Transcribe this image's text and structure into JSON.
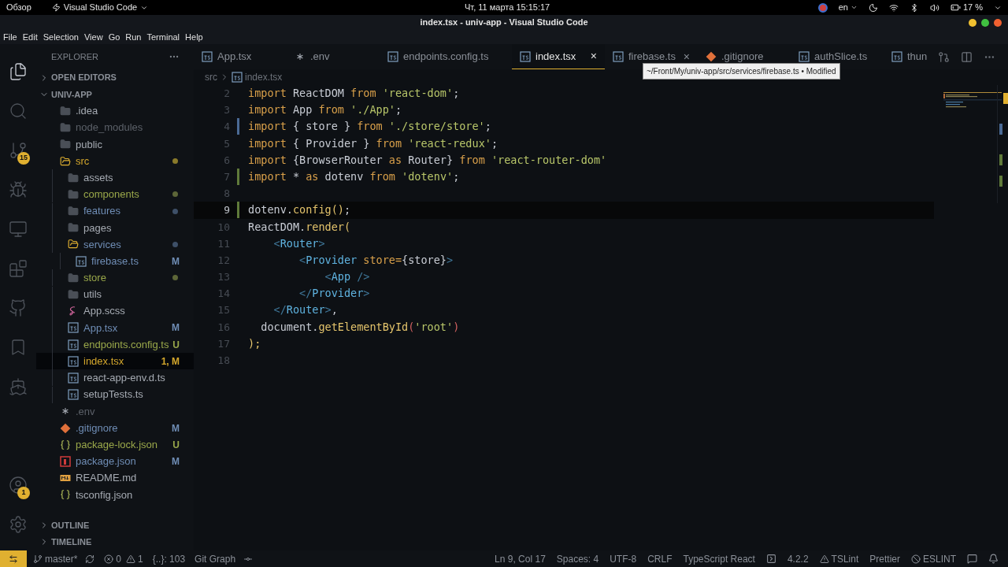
{
  "top_bar": {
    "activities": "Обзор",
    "app_menu": "Visual Studio Code",
    "clock": "Чт, 11 марта  15:15:17",
    "language": "en",
    "battery": "17 %"
  },
  "window": {
    "title": "index.tsx - univ-app - Visual Studio Code"
  },
  "menu": [
    "File",
    "Edit",
    "Selection",
    "View",
    "Go",
    "Run",
    "Terminal",
    "Help"
  ],
  "activity_bar": [
    {
      "kind": "explorer",
      "selected": true
    },
    {
      "kind": "search",
      "selected": false
    },
    {
      "kind": "git",
      "selected": false,
      "badge": "15"
    },
    {
      "kind": "run",
      "selected": false
    },
    {
      "kind": "remote",
      "selected": false
    },
    {
      "kind": "extensions",
      "selected": false
    },
    {
      "kind": "github",
      "selected": false
    },
    {
      "kind": "bookmark",
      "selected": false
    },
    {
      "kind": "docker",
      "selected": false
    }
  ],
  "activity_bottom": [
    {
      "kind": "account",
      "badge": "1"
    },
    {
      "kind": "settings"
    }
  ],
  "sidebar": {
    "title": "EXPLORER",
    "sections": [
      {
        "label": "OPEN EDITORS",
        "expanded": false
      },
      {
        "label": "UNIV-APP",
        "expanded": true,
        "items": [
          {
            "name": ".idea",
            "kind": "folder",
            "color": "#a6abb3"
          },
          {
            "name": "node_modules",
            "kind": "folder",
            "color": "#5b6068"
          },
          {
            "name": "public",
            "kind": "folder",
            "color": "#a6abb3"
          },
          {
            "name": "src",
            "kind": "folder",
            "expanded": true,
            "color": "#d4a72c",
            "dot": {
              "color": "#8a7a2a"
            },
            "children": [
              {
                "name": "assets",
                "kind": "folder",
                "color": "#a6abb3"
              },
              {
                "name": "components",
                "kind": "folder",
                "color": "#9aa84a",
                "dot": {
                  "color": "#5d6638"
                }
              },
              {
                "name": "features",
                "kind": "folder",
                "color": "#6f8db5",
                "dot": {
                  "color": "#3e5068"
                }
              },
              {
                "name": "pages",
                "kind": "folder",
                "color": "#a6abb3"
              },
              {
                "name": "services",
                "kind": "folder",
                "expanded": true,
                "color": "#6f8db5",
                "dot": {
                  "color": "#3e5068"
                },
                "children": [
                  {
                    "name": "firebase.ts",
                    "kind": "ts",
                    "color": "#6f8db5",
                    "status": "M"
                  }
                ]
              },
              {
                "name": "store",
                "kind": "folder",
                "color": "#9aa84a",
                "dot": {
                  "color": "#5d6638"
                }
              },
              {
                "name": "utils",
                "kind": "folder",
                "color": "#a6abb3"
              },
              {
                "name": "App.scss",
                "kind": "scss",
                "color": "#a6abb3"
              },
              {
                "name": "App.tsx",
                "kind": "ts",
                "color": "#6f8db5",
                "status": "M"
              },
              {
                "name": "endpoints.config.ts",
                "kind": "ts",
                "color": "#9aa84a",
                "status": "U"
              },
              {
                "name": "index.tsx",
                "kind": "ts",
                "color": "#d4a72c",
                "status": "1, M",
                "selected": true
              },
              {
                "name": "react-app-env.d.ts",
                "kind": "ts",
                "color": "#a6abb3"
              },
              {
                "name": "setupTests.ts",
                "kind": "ts",
                "color": "#a6abb3"
              }
            ]
          },
          {
            "name": ".env",
            "kind": "env",
            "color": "#5b6068"
          },
          {
            "name": ".gitignore",
            "kind": "git",
            "color": "#6f8db5",
            "status": "M"
          },
          {
            "name": "package-lock.json",
            "kind": "json",
            "color": "#9aa84a",
            "status": "U"
          },
          {
            "name": "package.json",
            "kind": "npm",
            "color": "#6f8db5",
            "status": "M"
          },
          {
            "name": "README.md",
            "kind": "md",
            "color": "#a6abb3"
          },
          {
            "name": "tsconfig.json",
            "kind": "json",
            "color": "#a6abb3"
          }
        ]
      },
      {
        "label": "OUTLINE",
        "expanded": false
      },
      {
        "label": "TIMELINE",
        "expanded": false
      }
    ]
  },
  "tabs": [
    {
      "label": "App.tsx",
      "kind": "ts",
      "selected": false
    },
    {
      "label": ".env",
      "kind": "env",
      "selected": false
    },
    {
      "label": "endpoints.config.ts",
      "kind": "ts",
      "selected": false
    },
    {
      "label": "index.tsx",
      "kind": "ts",
      "selected": true,
      "close": "×"
    },
    {
      "label": "firebase.ts",
      "kind": "ts",
      "selected": false,
      "close": "×"
    },
    {
      "label": ".gitignore",
      "kind": "git",
      "selected": false
    },
    {
      "label": "authSlice.ts",
      "kind": "ts",
      "selected": false
    },
    {
      "label": "thun",
      "kind": "ts",
      "selected": false
    }
  ],
  "tooltip": "~/Front/My/univ-app/src/services/firebase.ts • Modified",
  "breadcrumb": [
    "src",
    "index.tsx"
  ],
  "code": [
    {
      "number": "2",
      "tokens": [
        {
          "kind": "kw",
          "text": "import"
        },
        {
          "kind": "id",
          "text": " ReactDOM "
        },
        {
          "kind": "kw",
          "text": "from"
        },
        {
          "kind": "str",
          "text": " 'react-dom'"
        },
        {
          "kind": "punc",
          "text": ";"
        }
      ]
    },
    {
      "number": "3",
      "tokens": [
        {
          "kind": "kw",
          "text": "import"
        },
        {
          "kind": "id",
          "text": " App "
        },
        {
          "kind": "kw",
          "text": "from"
        },
        {
          "kind": "str",
          "text": " './App'"
        },
        {
          "kind": "punc",
          "text": ";"
        }
      ]
    },
    {
      "number": "4",
      "modified": true,
      "tokens": [
        {
          "kind": "kw",
          "text": "import"
        },
        {
          "kind": "id",
          "text": " { store } "
        },
        {
          "kind": "kw",
          "text": "from"
        },
        {
          "kind": "str",
          "text": " './store/store'"
        },
        {
          "kind": "punc",
          "text": ";"
        }
      ]
    },
    {
      "number": "5",
      "tokens": [
        {
          "kind": "kw",
          "text": "import"
        },
        {
          "kind": "id",
          "text": " { Provider } "
        },
        {
          "kind": "kw",
          "text": "from"
        },
        {
          "kind": "str",
          "text": " 'react-redux'"
        },
        {
          "kind": "punc",
          "text": ";"
        }
      ]
    },
    {
      "number": "6",
      "tokens": [
        {
          "kind": "kw",
          "text": "import"
        },
        {
          "kind": "id",
          "text": " {BrowserRouter "
        },
        {
          "kind": "kw",
          "text": "as"
        },
        {
          "kind": "id",
          "text": " Router} "
        },
        {
          "kind": "kw",
          "text": "from"
        },
        {
          "kind": "str",
          "text": " 'react-router-dom'"
        }
      ]
    },
    {
      "number": "7",
      "added": true,
      "tokens": [
        {
          "kind": "kw",
          "text": "import"
        },
        {
          "kind": "id",
          "text": " * "
        },
        {
          "kind": "kw",
          "text": "as"
        },
        {
          "kind": "id",
          "text": " dotenv "
        },
        {
          "kind": "kw",
          "text": "from"
        },
        {
          "kind": "str",
          "text": " 'dotenv'"
        },
        {
          "kind": "punc",
          "text": ";"
        }
      ]
    },
    {
      "number": "8"
    },
    {
      "number": "9",
      "added": true,
      "current": true,
      "tokens": [
        {
          "kind": "id",
          "text": "dotenv."
        },
        {
          "kind": "fn",
          "text": "config"
        },
        {
          "kind": "fn",
          "text": "()"
        },
        {
          "kind": "punc",
          "text": ";"
        }
      ]
    },
    {
      "number": "10",
      "tokens": [
        {
          "kind": "id",
          "text": "ReactDOM."
        },
        {
          "kind": "fn",
          "text": "render("
        }
      ]
    },
    {
      "number": "11",
      "tokens": [
        {
          "kind": "tagp",
          "text": "    <"
        },
        {
          "kind": "tag",
          "text": "Router"
        },
        {
          "kind": "tagp",
          "text": ">"
        }
      ]
    },
    {
      "number": "12",
      "tokens": [
        {
          "kind": "tagp",
          "text": "        <"
        },
        {
          "kind": "tag",
          "text": "Provider"
        },
        {
          "kind": "attr",
          "text": " store="
        },
        {
          "kind": "id",
          "text": "{store}"
        },
        {
          "kind": "tagp",
          "text": ">"
        }
      ]
    },
    {
      "number": "13",
      "tokens": [
        {
          "kind": "tagp",
          "text": "            <"
        },
        {
          "kind": "tag",
          "text": "App"
        },
        {
          "kind": "tagp",
          "text": " />"
        }
      ]
    },
    {
      "number": "14",
      "tokens": [
        {
          "kind": "tagp",
          "text": "        </"
        },
        {
          "kind": "tag",
          "text": "Provider"
        },
        {
          "kind": "tagp",
          "text": ">"
        }
      ]
    },
    {
      "number": "15",
      "tokens": [
        {
          "kind": "tagp",
          "text": "    </"
        },
        {
          "kind": "tag",
          "text": "Router"
        },
        {
          "kind": "tagp",
          "text": ">"
        },
        {
          "kind": "punc",
          "text": ","
        }
      ]
    },
    {
      "number": "16",
      "tokens": [
        {
          "kind": "id",
          "text": "  document."
        },
        {
          "kind": "fn",
          "text": "getElementById"
        },
        {
          "kind": "paren",
          "text": "("
        },
        {
          "kind": "str",
          "text": "'root'"
        },
        {
          "kind": "paren",
          "text": ")"
        }
      ]
    },
    {
      "number": "17",
      "tokens": [
        {
          "kind": "fn",
          "text": ");"
        }
      ]
    },
    {
      "number": "18"
    }
  ],
  "status_bar": {
    "branch": "master*",
    "errors": "0",
    "warnings": "1",
    "symbols": "{..}: 103",
    "git_graph": "Git Graph",
    "right": [
      {
        "kind": "text",
        "text": "Ln 9, Col 17"
      },
      {
        "kind": "text",
        "text": "Spaces: 4"
      },
      {
        "kind": "text",
        "text": "UTF-8"
      },
      {
        "kind": "text",
        "text": "CRLF"
      },
      {
        "kind": "text",
        "text": "TypeScript React"
      },
      {
        "kind": "box"
      },
      {
        "kind": "text",
        "text": "4.2.2"
      },
      {
        "kind": "warn",
        "text": "TSLint"
      },
      {
        "kind": "text",
        "text": "Prettier"
      },
      {
        "kind": "ban",
        "text": "ESLINT"
      },
      {
        "kind": "feedback"
      },
      {
        "kind": "bell"
      }
    ]
  }
}
